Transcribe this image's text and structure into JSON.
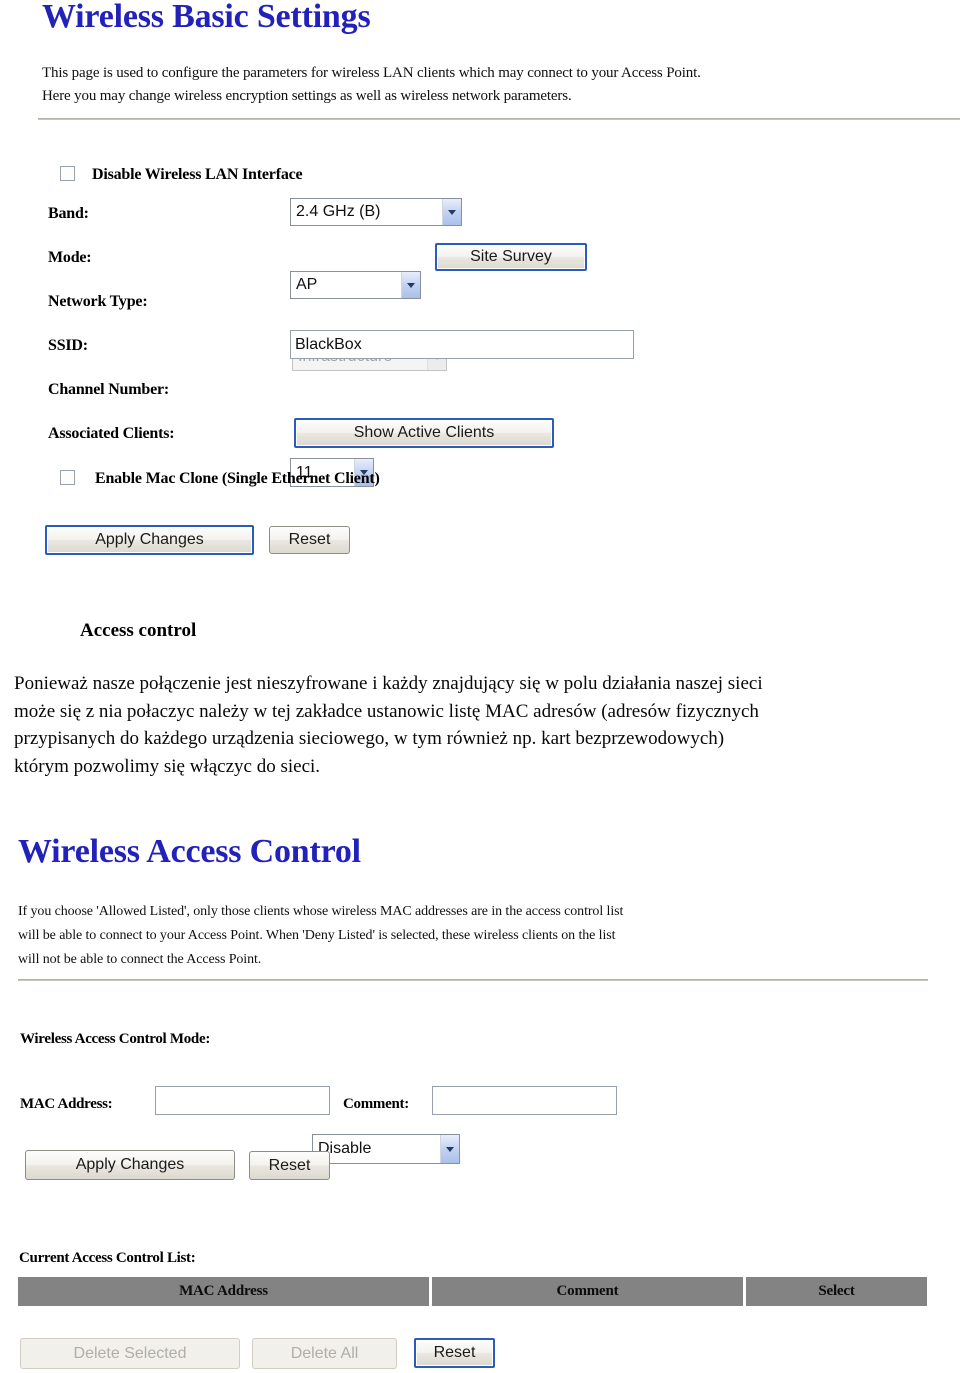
{
  "basic_settings": {
    "title": "Wireless Basic Settings",
    "description_line1": "This page is used to configure the parameters for wireless LAN clients which may connect to your Access Point.",
    "description_line2": "Here you may change wireless encryption settings as well as wireless network parameters.",
    "disable_wlan_label": "Disable Wireless LAN Interface",
    "disable_wlan_checked": false,
    "band_label": "Band:",
    "band_value": "2.4 GHz (B)",
    "mode_label": "Mode:",
    "mode_value": "AP",
    "site_survey_label": "Site Survey",
    "network_type_label": "Network Type:",
    "network_type_value": "Infrastructure",
    "network_type_disabled": true,
    "ssid_label": "SSID:",
    "ssid_value": "BlackBox",
    "channel_label": "Channel Number:",
    "channel_value": "11",
    "associated_clients_label": "Associated Clients:",
    "show_active_clients_label": "Show Active Clients",
    "mac_clone_label": "Enable Mac Clone (Single Ethernet Client)",
    "mac_clone_checked": false,
    "apply_label": "Apply Changes",
    "reset_label": "Reset"
  },
  "article": {
    "heading": "Access control",
    "line1": "Ponieważ nasze połączenie jest nieszyfrowane i każdy znajdujący się w polu działania naszej sieci",
    "line2": "może się z nia połaczyc należy w tej zakładce ustanowic listę MAC adresów (adresów fizycznych",
    "line3": "przypisanych do każdego urządzenia sieciowego, w tym również np. kart bezprzewodowych)",
    "line4": "którym pozwolimy się włączyc do sieci."
  },
  "access_control": {
    "title": "Wireless Access Control",
    "description_line1": "If you choose 'Allowed Listed', only those clients whose wireless MAC addresses are in the access control list",
    "description_line2": "will be able to connect to your Access Point. When 'Deny Listed' is selected, these wireless clients on the list",
    "description_line3": "will not be able to connect the Access Point.",
    "mode_label": "Wireless Access Control Mode:",
    "mode_value": "Disable",
    "mac_address_label": "MAC Address:",
    "mac_address_value": "",
    "comment_label": "Comment:",
    "comment_value": "",
    "apply_label": "Apply Changes",
    "reset_label": "Reset",
    "list_heading": "Current Access Control List:",
    "table": {
      "columns": [
        "MAC Address",
        "Comment",
        "Select"
      ],
      "rows": []
    },
    "delete_selected_label": "Delete Selected",
    "delete_all_label": "Delete All",
    "bottom_reset_label": "Reset"
  },
  "colors": {
    "heading_blue": "#2222BB",
    "table_header_gray": "#838383",
    "focus_blue": "#2b5bbd"
  }
}
